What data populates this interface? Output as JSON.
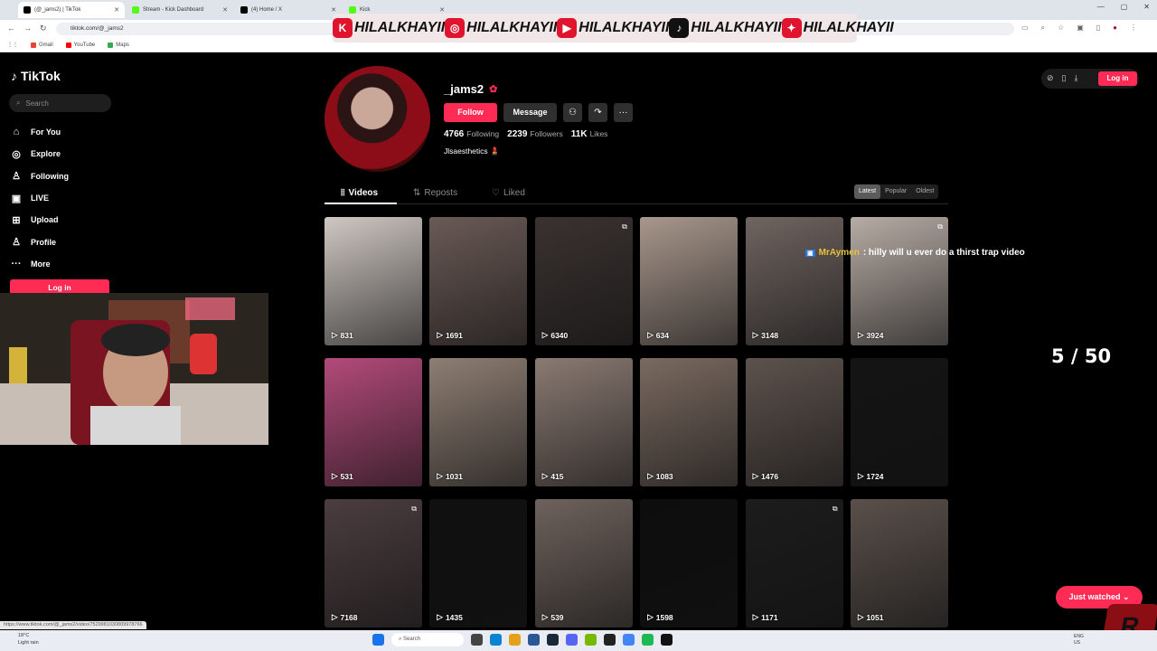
{
  "browser": {
    "tabs": [
      {
        "title": "(@_jams2) | TikTok",
        "favicon": "#000000",
        "active": true
      },
      {
        "title": "Stream - Kick Dashboard",
        "favicon": "#53fc18",
        "active": false
      },
      {
        "title": "(4) Home / X",
        "favicon": "#000000",
        "active": false
      },
      {
        "title": "Kick",
        "favicon": "#53fc18",
        "active": false
      }
    ],
    "url": "tiktok.com/@_jams2",
    "bookmarks": [
      "Gmail",
      "YouTube",
      "Maps"
    ],
    "status_url": "https://www.tiktok.com/@_jams2/video/7529981030809978766"
  },
  "overlay": {
    "handles": [
      {
        "platform": "kick-icon",
        "handle": "HILALKHAYII",
        "color": "#e0142d",
        "glyph": "K"
      },
      {
        "platform": "instagram-icon",
        "handle": "HILALKHAYII",
        "color": "#e0142d",
        "glyph": "◎"
      },
      {
        "platform": "youtube-icon",
        "handle": "HILALKHAYII",
        "color": "#e0142d",
        "glyph": "▶"
      },
      {
        "platform": "tiktok-icon",
        "handle": "HILALKHAYII",
        "color": "#111111",
        "glyph": "♪"
      },
      {
        "platform": "twitter-icon",
        "handle": "HILALKHAYII",
        "color": "#e0142d",
        "glyph": "✦"
      }
    ],
    "chat": {
      "name": "MrAymen",
      "message": ": hilly will u ever do a thirst trap video"
    },
    "counter": "5 / 50"
  },
  "tiktok": {
    "brand": "TikTok",
    "search_placeholder": "Search",
    "nav": [
      {
        "label": "For You",
        "icon": "home-icon",
        "glyph": "⌂"
      },
      {
        "label": "Explore",
        "icon": "compass-icon",
        "glyph": "◎"
      },
      {
        "label": "Following",
        "icon": "person-icon",
        "glyph": "♙"
      },
      {
        "label": "LIVE",
        "icon": "live-icon",
        "glyph": "▣"
      },
      {
        "label": "Upload",
        "icon": "plus-square-icon",
        "glyph": "⊞"
      },
      {
        "label": "Profile",
        "icon": "profile-icon",
        "glyph": "♙"
      },
      {
        "label": "More",
        "icon": "more-icon",
        "glyph": "···"
      }
    ],
    "login_label": "Log in",
    "top_login": "Log in"
  },
  "profile": {
    "username": "_jams2",
    "follow_label": "Follow",
    "message_label": "Message",
    "following_count": "4766",
    "following_label": "Following",
    "followers_count": "2239",
    "followers_label": "Followers",
    "likes_count": "11K",
    "likes_label": "Likes",
    "bio": "Jlsaesthetics 💄",
    "tabs": [
      "Videos",
      "Reposts",
      "Liked"
    ],
    "sort": [
      "Latest",
      "Popular",
      "Oldest"
    ]
  },
  "videos": [
    {
      "views": "831",
      "bg": "#cfc7c2",
      "badge": false
    },
    {
      "views": "1691",
      "bg": "#6a5a55",
      "badge": false
    },
    {
      "views": "6340",
      "bg": "#3a3230",
      "badge": true
    },
    {
      "views": "634",
      "bg": "#a8978c",
      "badge": false
    },
    {
      "views": "3148",
      "bg": "#6f6460",
      "badge": false
    },
    {
      "views": "3924",
      "bg": "#b7aca5",
      "badge": true
    },
    {
      "views": "531",
      "bg": "#b34a7a",
      "badge": false
    },
    {
      "views": "1031",
      "bg": "#8e7e73",
      "badge": false
    },
    {
      "views": "415",
      "bg": "#8a7a72",
      "badge": false
    },
    {
      "views": "1083",
      "bg": "#7a6a60",
      "badge": false
    },
    {
      "views": "1476",
      "bg": "#5d524d",
      "badge": false
    },
    {
      "views": "1724",
      "bg": "#141414",
      "badge": false
    },
    {
      "views": "7168",
      "bg": "#4b3d40",
      "badge": true
    },
    {
      "views": "1435",
      "bg": "#101010",
      "badge": false
    },
    {
      "views": "539",
      "bg": "#6e625c",
      "badge": false
    },
    {
      "views": "1598",
      "bg": "#0d0d0d",
      "badge": false
    },
    {
      "views": "1171",
      "bg": "#1c1c1c",
      "badge": true
    },
    {
      "views": "1051",
      "bg": "#5a504b",
      "badge": false
    }
  ],
  "just_watched": "Just watched ⌄",
  "taskbar": {
    "weather_temp": "18°C",
    "weather_desc": "Light rain",
    "search": "Search",
    "lang": "ENG",
    "region": "US"
  }
}
